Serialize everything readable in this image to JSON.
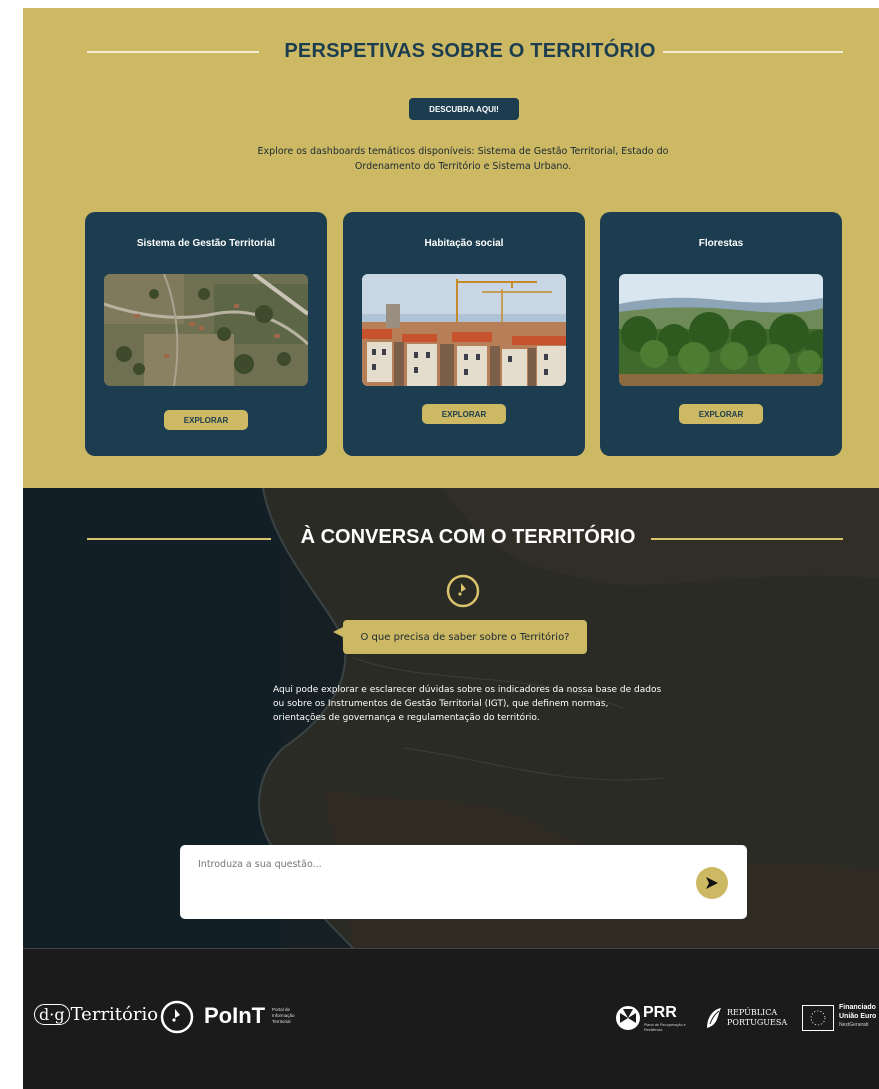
{
  "perspectives": {
    "title": "PERSPETIVAS SOBRE O TERRITÓRIO",
    "discover_label": "DESCUBRA AQUI!",
    "intro": "Explore os dashboards temáticos disponíveis: Sistema de Gestão Territorial, Estado do Ordenamento do Território e Sistema Urbano.",
    "cards": [
      {
        "title": "Sistema de Gestão Territorial",
        "button": "EXPLORAR"
      },
      {
        "title": "Habitação social",
        "button": "EXPLORAR"
      },
      {
        "title": "Florestas",
        "button": "EXPLORAR"
      }
    ]
  },
  "conversation": {
    "title": "À CONVERSA COM O TERRITÓRIO",
    "bubble": "O que precisa de saber sobre o Território?",
    "description": "Aqui pode explorar e esclarecer dúvidas sobre os indicadores da nossa base de dados ou sobre os Instrumentos de Gestão Territorial (IGT), que definem normas, orientações de governança e regulamentação do território.",
    "input_placeholder": "Introduza a sua questão..."
  },
  "footer": {
    "dgt_prefix": "d·g",
    "dgt_word": "Território",
    "point_word": "PoInT",
    "point_small": "Portal de Informação Territorial",
    "prr_word": "PRR",
    "prr_small": "Plano de Recuperação e Resiliência",
    "rp_word": "REPÚBLICA PORTUGUESA",
    "eu_line1": "Financiado",
    "eu_line2": "União Euro",
    "eu_line3": "NextGenerati"
  },
  "colors": {
    "gold": "#cdb863",
    "navy": "#1b3d4f",
    "footer": "#1b1b1b"
  }
}
